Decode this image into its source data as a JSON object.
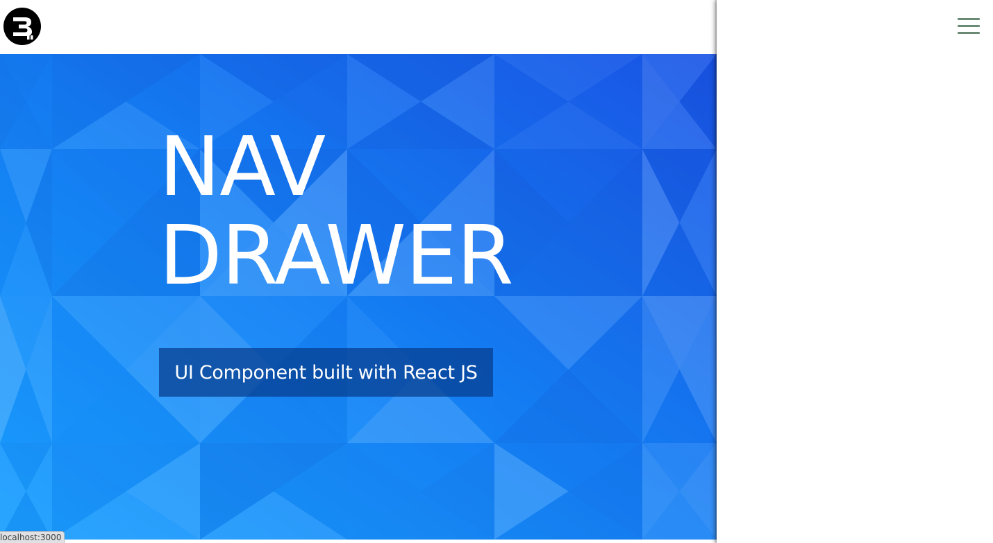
{
  "header": {
    "logo_icon": "brand-logo-icon"
  },
  "hero": {
    "title_line1": "NAV",
    "title_line2": "DRAWER",
    "subtitle": "UI Component built with React JS",
    "background_color": "#1673f0",
    "background_pattern": "low-poly-triangles"
  },
  "drawer": {
    "menu_icon": "hamburger-menu-icon",
    "menu_icon_color": "#6b8a74",
    "background_color": "#ffffff"
  },
  "status_bar": {
    "url": "localhost:3000"
  }
}
